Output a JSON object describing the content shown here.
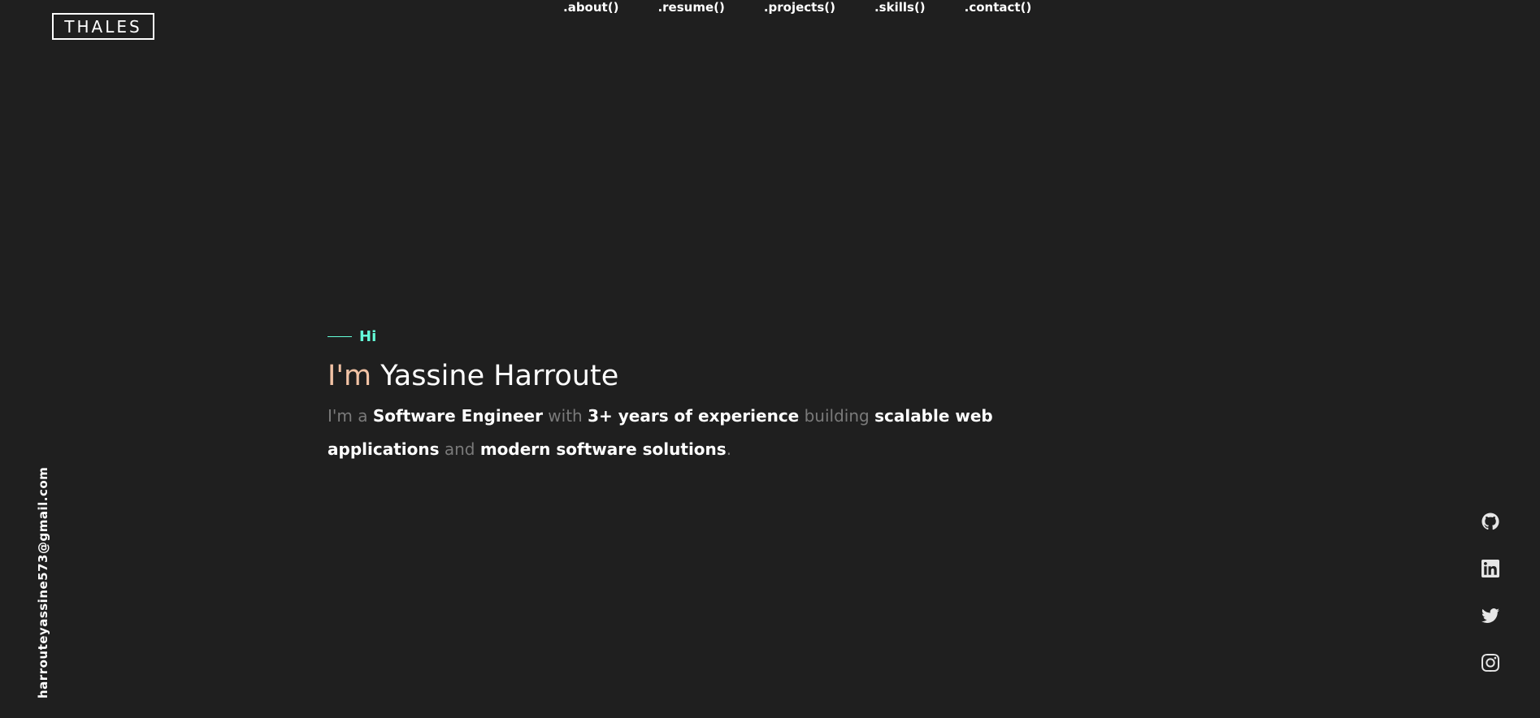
{
  "header": {
    "logo_text": "THALES",
    "nav": [
      {
        "label": ".about()"
      },
      {
        "label": ".resume()"
      },
      {
        "label": ".projects()"
      },
      {
        "label": ".skills()"
      },
      {
        "label": ".contact()"
      }
    ]
  },
  "hero": {
    "greeting": "Hi",
    "title_prefix": "I'm",
    "title_name": "Yassine Harroute",
    "desc": {
      "p1": "I'm a ",
      "b1": "Software Engineer",
      "p2": " with ",
      "b2": "3+ years of experience",
      "p3": " building ",
      "b3": "scalable web applications",
      "p4": " and ",
      "b4": "modern software solutions",
      "p5": "."
    }
  },
  "sidebar_left": {
    "email": "harrouteyassine573@gmail.com"
  },
  "socials": [
    {
      "icon": "github-icon"
    },
    {
      "icon": "linkedin-icon"
    },
    {
      "icon": "twitter-icon"
    },
    {
      "icon": "instagram-icon"
    }
  ],
  "colors": {
    "background": "#1f1f1f",
    "accent": "#64ffda",
    "title_prefix": "#f2c3a5",
    "muted": "#7a7a7a"
  }
}
